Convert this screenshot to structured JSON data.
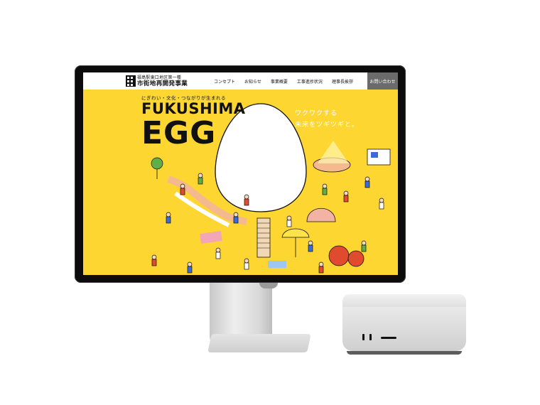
{
  "site": {
    "logo_line1": "福島駅東口地区第一種",
    "logo_line2": "市街地再開発事業",
    "nav": [
      "コンセプト",
      "お知らせ",
      "事業概要",
      "工事進捗状況",
      "理事長挨拶"
    ],
    "contact_label": "お問い合わせ",
    "tagline": "にぎわい・文化・つながりが生まれる",
    "title_line1": "FUKUSHIMA",
    "title_line2": "EGG",
    "catch_line1": "ワクワクする",
    "catch_line2": "未来をツギツギと。"
  },
  "colors": {
    "brand_yellow": "#fdd631",
    "contact_bg": "#6b6b6b",
    "text": "#111111"
  },
  "icons": {
    "logo": "building-logo-icon"
  }
}
